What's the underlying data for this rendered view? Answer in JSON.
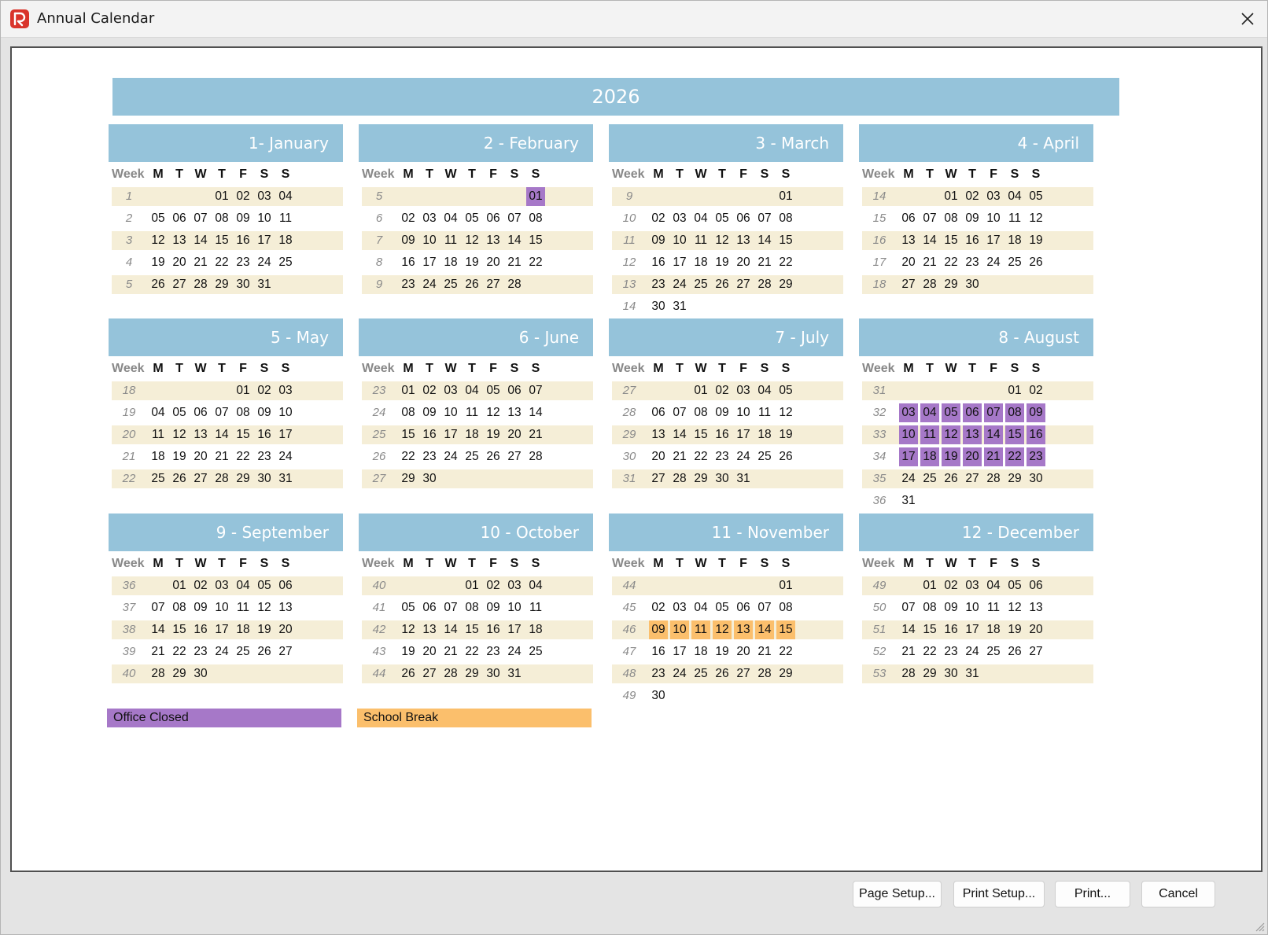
{
  "window": {
    "title": "Annual Calendar",
    "app_icon": "app-logo-icon",
    "close_icon": "close-icon"
  },
  "calendar": {
    "year": "2026",
    "week_label": "Week",
    "dow": [
      "M",
      "T",
      "W",
      "T",
      "F",
      "S",
      "S"
    ],
    "months": [
      {
        "title": "1- January",
        "weeks": [
          {
            "n": "1",
            "days": [
              "",
              "",
              "",
              "01",
              "02",
              "03",
              "04"
            ]
          },
          {
            "n": "2",
            "days": [
              "05",
              "06",
              "07",
              "08",
              "09",
              "10",
              "11"
            ]
          },
          {
            "n": "3",
            "days": [
              "12",
              "13",
              "14",
              "15",
              "16",
              "17",
              "18"
            ]
          },
          {
            "n": "4",
            "days": [
              "19",
              "20",
              "21",
              "22",
              "23",
              "24",
              "25"
            ]
          },
          {
            "n": "5",
            "days": [
              "26",
              "27",
              "28",
              "29",
              "30",
              "31",
              ""
            ]
          }
        ]
      },
      {
        "title": "2 - February",
        "weeks": [
          {
            "n": "5",
            "days": [
              "",
              "",
              "",
              "",
              "",
              "",
              "01"
            ]
          },
          {
            "n": "6",
            "days": [
              "02",
              "03",
              "04",
              "05",
              "06",
              "07",
              "08"
            ]
          },
          {
            "n": "7",
            "days": [
              "09",
              "10",
              "11",
              "12",
              "13",
              "14",
              "15"
            ]
          },
          {
            "n": "8",
            "days": [
              "16",
              "17",
              "18",
              "19",
              "20",
              "21",
              "22"
            ]
          },
          {
            "n": "9",
            "days": [
              "23",
              "24",
              "25",
              "26",
              "27",
              "28",
              ""
            ]
          }
        ]
      },
      {
        "title": "3 - March",
        "weeks": [
          {
            "n": "9",
            "days": [
              "",
              "",
              "",
              "",
              "",
              "",
              "01"
            ]
          },
          {
            "n": "10",
            "days": [
              "02",
              "03",
              "04",
              "05",
              "06",
              "07",
              "08"
            ]
          },
          {
            "n": "11",
            "days": [
              "09",
              "10",
              "11",
              "12",
              "13",
              "14",
              "15"
            ]
          },
          {
            "n": "12",
            "days": [
              "16",
              "17",
              "18",
              "19",
              "20",
              "21",
              "22"
            ]
          },
          {
            "n": "13",
            "days": [
              "23",
              "24",
              "25",
              "26",
              "27",
              "28",
              "29"
            ]
          },
          {
            "n": "14",
            "days": [
              "30",
              "31",
              "",
              "",
              "",
              "",
              ""
            ]
          }
        ]
      },
      {
        "title": "4 - April",
        "weeks": [
          {
            "n": "14",
            "days": [
              "",
              "",
              "01",
              "02",
              "03",
              "04",
              "05"
            ]
          },
          {
            "n": "15",
            "days": [
              "06",
              "07",
              "08",
              "09",
              "10",
              "11",
              "12"
            ]
          },
          {
            "n": "16",
            "days": [
              "13",
              "14",
              "15",
              "16",
              "17",
              "18",
              "19"
            ]
          },
          {
            "n": "17",
            "days": [
              "20",
              "21",
              "22",
              "23",
              "24",
              "25",
              "26"
            ]
          },
          {
            "n": "18",
            "days": [
              "27",
              "28",
              "29",
              "30",
              "",
              "",
              ""
            ]
          }
        ]
      },
      {
        "title": "5 - May",
        "weeks": [
          {
            "n": "18",
            "days": [
              "",
              "",
              "",
              "",
              "01",
              "02",
              "03"
            ]
          },
          {
            "n": "19",
            "days": [
              "04",
              "05",
              "06",
              "07",
              "08",
              "09",
              "10"
            ]
          },
          {
            "n": "20",
            "days": [
              "11",
              "12",
              "13",
              "14",
              "15",
              "16",
              "17"
            ]
          },
          {
            "n": "21",
            "days": [
              "18",
              "19",
              "20",
              "21",
              "22",
              "23",
              "24"
            ]
          },
          {
            "n": "22",
            "days": [
              "25",
              "26",
              "27",
              "28",
              "29",
              "30",
              "31"
            ]
          }
        ]
      },
      {
        "title": "6 - June",
        "weeks": [
          {
            "n": "23",
            "days": [
              "01",
              "02",
              "03",
              "04",
              "05",
              "06",
              "07"
            ]
          },
          {
            "n": "24",
            "days": [
              "08",
              "09",
              "10",
              "11",
              "12",
              "13",
              "14"
            ]
          },
          {
            "n": "25",
            "days": [
              "15",
              "16",
              "17",
              "18",
              "19",
              "20",
              "21"
            ]
          },
          {
            "n": "26",
            "days": [
              "22",
              "23",
              "24",
              "25",
              "26",
              "27",
              "28"
            ]
          },
          {
            "n": "27",
            "days": [
              "29",
              "30",
              "",
              "",
              "",
              "",
              ""
            ]
          }
        ]
      },
      {
        "title": "7 - July",
        "weeks": [
          {
            "n": "27",
            "days": [
              "",
              "",
              "01",
              "02",
              "03",
              "04",
              "05"
            ]
          },
          {
            "n": "28",
            "days": [
              "06",
              "07",
              "08",
              "09",
              "10",
              "11",
              "12"
            ]
          },
          {
            "n": "29",
            "days": [
              "13",
              "14",
              "15",
              "16",
              "17",
              "18",
              "19"
            ]
          },
          {
            "n": "30",
            "days": [
              "20",
              "21",
              "22",
              "23",
              "24",
              "25",
              "26"
            ]
          },
          {
            "n": "31",
            "days": [
              "27",
              "28",
              "29",
              "30",
              "31",
              "",
              ""
            ]
          }
        ]
      },
      {
        "title": "8 - August",
        "weeks": [
          {
            "n": "31",
            "days": [
              "",
              "",
              "",
              "",
              "",
              "01",
              "02"
            ]
          },
          {
            "n": "32",
            "days": [
              "03",
              "04",
              "05",
              "06",
              "07",
              "08",
              "09"
            ]
          },
          {
            "n": "33",
            "days": [
              "10",
              "11",
              "12",
              "13",
              "14",
              "15",
              "16"
            ]
          },
          {
            "n": "34",
            "days": [
              "17",
              "18",
              "19",
              "20",
              "21",
              "22",
              "23"
            ]
          },
          {
            "n": "35",
            "days": [
              "24",
              "25",
              "26",
              "27",
              "28",
              "29",
              "30"
            ]
          },
          {
            "n": "36",
            "days": [
              "31",
              "",
              "",
              "",
              "",
              "",
              ""
            ]
          }
        ]
      },
      {
        "title": "9 - September",
        "weeks": [
          {
            "n": "36",
            "days": [
              "",
              "01",
              "02",
              "03",
              "04",
              "05",
              "06"
            ]
          },
          {
            "n": "37",
            "days": [
              "07",
              "08",
              "09",
              "10",
              "11",
              "12",
              "13"
            ]
          },
          {
            "n": "38",
            "days": [
              "14",
              "15",
              "16",
              "17",
              "18",
              "19",
              "20"
            ]
          },
          {
            "n": "39",
            "days": [
              "21",
              "22",
              "23",
              "24",
              "25",
              "26",
              "27"
            ]
          },
          {
            "n": "40",
            "days": [
              "28",
              "29",
              "30",
              "",
              "",
              "",
              ""
            ]
          }
        ]
      },
      {
        "title": "10 - October",
        "weeks": [
          {
            "n": "40",
            "days": [
              "",
              "",
              "",
              "01",
              "02",
              "03",
              "04"
            ]
          },
          {
            "n": "41",
            "days": [
              "05",
              "06",
              "07",
              "08",
              "09",
              "10",
              "11"
            ]
          },
          {
            "n": "42",
            "days": [
              "12",
              "13",
              "14",
              "15",
              "16",
              "17",
              "18"
            ]
          },
          {
            "n": "43",
            "days": [
              "19",
              "20",
              "21",
              "22",
              "23",
              "24",
              "25"
            ]
          },
          {
            "n": "44",
            "days": [
              "26",
              "27",
              "28",
              "29",
              "30",
              "31",
              ""
            ]
          }
        ]
      },
      {
        "title": "11 - November",
        "weeks": [
          {
            "n": "44",
            "days": [
              "",
              "",
              "",
              "",
              "",
              "",
              "01"
            ]
          },
          {
            "n": "45",
            "days": [
              "02",
              "03",
              "04",
              "05",
              "06",
              "07",
              "08"
            ]
          },
          {
            "n": "46",
            "days": [
              "09",
              "10",
              "11",
              "12",
              "13",
              "14",
              "15"
            ]
          },
          {
            "n": "47",
            "days": [
              "16",
              "17",
              "18",
              "19",
              "20",
              "21",
              "22"
            ]
          },
          {
            "n": "48",
            "days": [
              "23",
              "24",
              "25",
              "26",
              "27",
              "28",
              "29"
            ]
          },
          {
            "n": "49",
            "days": [
              "30",
              "",
              "",
              "",
              "",
              "",
              ""
            ]
          }
        ]
      },
      {
        "title": "12 - December",
        "weeks": [
          {
            "n": "49",
            "days": [
              "",
              "01",
              "02",
              "03",
              "04",
              "05",
              "06"
            ]
          },
          {
            "n": "50",
            "days": [
              "07",
              "08",
              "09",
              "10",
              "11",
              "12",
              "13"
            ]
          },
          {
            "n": "51",
            "days": [
              "14",
              "15",
              "16",
              "17",
              "18",
              "19",
              "20"
            ]
          },
          {
            "n": "52",
            "days": [
              "21",
              "22",
              "23",
              "24",
              "25",
              "26",
              "27"
            ]
          },
          {
            "n": "53",
            "days": [
              "28",
              "29",
              "30",
              "31",
              "",
              "",
              ""
            ]
          }
        ]
      }
    ],
    "highlights": [
      {
        "month": 1,
        "week": 0,
        "cols": [
          3,
          4,
          5,
          6
        ],
        "type": "closed"
      },
      {
        "month": 7,
        "week": 1,
        "cols": [
          0,
          1,
          2,
          3,
          4,
          5,
          6
        ],
        "type": "closed"
      },
      {
        "month": 7,
        "week": 2,
        "cols": [
          0,
          1,
          2,
          3,
          4,
          5,
          6
        ],
        "type": "closed"
      },
      {
        "month": 7,
        "week": 3,
        "cols": [
          0,
          1,
          2,
          3,
          4,
          5,
          6
        ],
        "type": "closed"
      },
      {
        "month": 10,
        "week": 2,
        "cols": [
          0,
          1,
          2,
          3,
          4,
          5,
          6
        ],
        "type": "school"
      }
    ],
    "legend": [
      {
        "label": "Office Closed",
        "type": "closed",
        "color": "#a678c8"
      },
      {
        "label": "School Break",
        "type": "school",
        "color": "#fbbf6c"
      }
    ],
    "colors": {
      "header": "#95c3da",
      "row_shade": "#f5eed7",
      "closed": "#a678c8",
      "school": "#fbbf6c"
    }
  },
  "buttons": {
    "page_setup": "Page Setup...",
    "print_setup": "Print Setup...",
    "print": "Print...",
    "cancel": "Cancel"
  }
}
